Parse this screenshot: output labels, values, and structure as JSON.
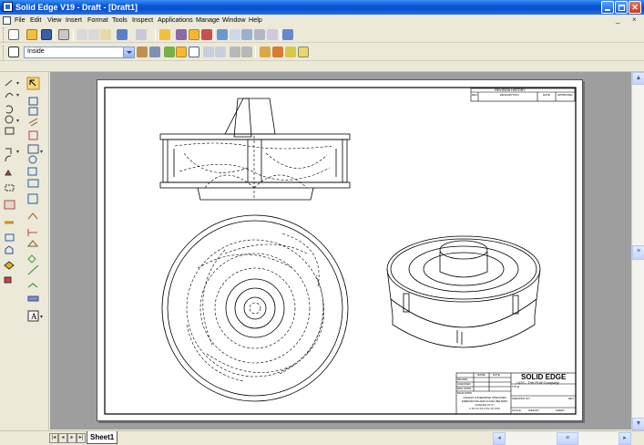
{
  "window": {
    "title": "Solid Edge V19 - Draft - [Draft1]",
    "controls": [
      "minimize",
      "maximize",
      "close"
    ]
  },
  "menubar": {
    "items": [
      "File",
      "Edit",
      "View",
      "Insert",
      "Format",
      "Tools",
      "Inspect",
      "Applications",
      "Manage",
      "Window",
      "Help"
    ],
    "mdi_controls": [
      "_",
      "×"
    ]
  },
  "toolbar2": {
    "plane_select": "Inside"
  },
  "title_block": {
    "company": "SOLID EDGE",
    "tagline": "UGS - The PLM Company",
    "revision_history_header": "REVISION HISTORY",
    "revision_columns": [
      "REV",
      "DESCRIPTION",
      "DATE",
      "APPROVED"
    ],
    "rows_left": [
      "DRAWN",
      "CHECKED",
      "ENG APPR",
      "MGR APPR"
    ],
    "col_labels": [
      "NAME",
      "DATE"
    ],
    "field_labels": [
      "TITLE",
      "SIZE",
      "DWG NO",
      "REV",
      "SCALE",
      "WEIGHT",
      "SHEET"
    ],
    "notes": [
      "UNLESS OTHERWISE SPECIFIED",
      "DIMENSIONS ARE IN MILLIMETERS",
      "ANGLES ±X.X°",
      "2 PL ±X.XX 3 PL ±X.XXX"
    ]
  },
  "sheet_tabs": {
    "active": "Sheet1"
  },
  "colors": {
    "titlebar": "#0a58d8",
    "canvas": "#9e9e9e",
    "sheet": "#ffffff",
    "chrome": "#ece9d8",
    "highlight_tool": "#f7b733"
  },
  "icons": {
    "left_tools": [
      "line-icon",
      "select-icon",
      "arc-icon",
      "circle-icon",
      "rectangle-icon",
      "curve-icon",
      "fillet-icon",
      "dimension-icon",
      "symbol-icon",
      "view-icon",
      "section-icon",
      "detail-icon",
      "annotation-icon",
      "text-icon"
    ]
  }
}
